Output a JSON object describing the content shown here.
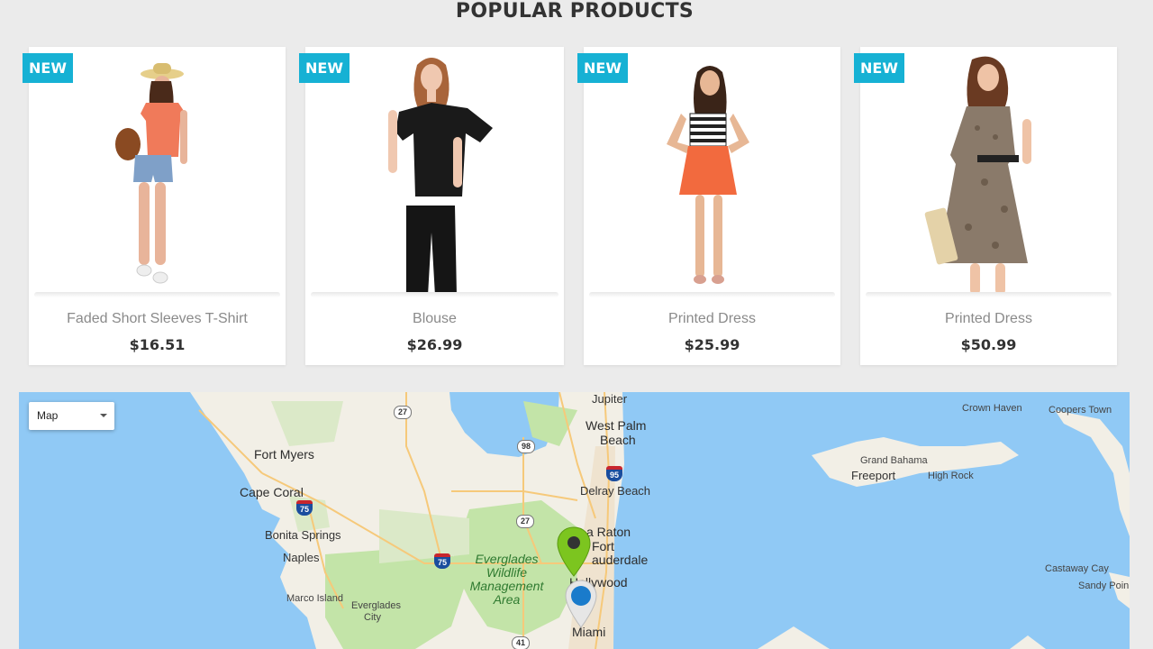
{
  "section": {
    "title": "POPULAR PRODUCTS"
  },
  "products": [
    {
      "badge": "NEW",
      "name": "Faded Short Sleeves T-Shirt",
      "price": "$16.51"
    },
    {
      "badge": "NEW",
      "name": "Blouse",
      "price": "$26.99"
    },
    {
      "badge": "NEW",
      "name": "Printed Dress",
      "price": "$25.99"
    },
    {
      "badge": "NEW",
      "name": "Printed Dress",
      "price": "$50.99"
    }
  ],
  "map": {
    "type_control": "Map",
    "places": {
      "jupiter": "Jupiter",
      "west_palm": "West Palm",
      "beach": "Beach",
      "fort_myers": "Fort Myers",
      "cape_coral": "Cape Coral",
      "delray": "Delray Beach",
      "boca": "a Raton",
      "fort": "Fort",
      "lauderdale": "auderdale",
      "hollywood": "Hollywood",
      "miami": "Miami",
      "bonita": "Bonita Springs",
      "naples": "Naples",
      "marco": "Marco Island",
      "everglades_city": "Everglades",
      "everglades_city2": "City",
      "park1": "Everglades",
      "park2": "Wildlife",
      "park3": "Management",
      "park4": "Area",
      "crown_haven": "Crown Haven",
      "coopers": "Coopers Town",
      "grand_bahama": "Grand Bahama",
      "freeport": "Freeport",
      "high_rock": "High Rock",
      "castaway": "Castaway Cay",
      "sandy": "Sandy Poin"
    },
    "shields": {
      "s27a": "27",
      "s98": "98",
      "s95a": "95",
      "s75a": "75",
      "s27b": "27",
      "s75b": "75",
      "s41": "41"
    },
    "colors": {
      "water": "#90c9f5",
      "land": "#f2efe6",
      "park": "#c3e4a8",
      "road": "#f6c97a",
      "marker_green": "#7cc51f",
      "marker_blue": "#1a7bcb"
    }
  }
}
